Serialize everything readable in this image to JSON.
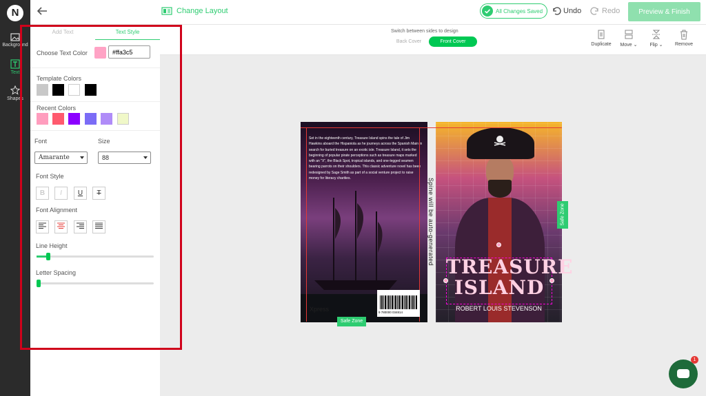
{
  "sidebar": {
    "logo": "N",
    "items": [
      {
        "label": "Background"
      },
      {
        "label": "Text"
      },
      {
        "label": "Shapes"
      }
    ]
  },
  "topbar": {
    "change_layout": "Change Layout",
    "saved": "All Changes Saved",
    "undo": "Undo",
    "redo": "Redo",
    "preview": "Preview & Finish"
  },
  "subbar": {
    "switch_label": "Switch between sides to design",
    "back_cover": "Back Cover",
    "front_cover": "Front Cover",
    "tools": [
      {
        "label": "Duplicate"
      },
      {
        "label": "Move"
      },
      {
        "label": "Flip"
      },
      {
        "label": "Remove"
      }
    ]
  },
  "panel": {
    "tabs": [
      "Add Text",
      "Text Style"
    ],
    "choose_color": "Choose Text Color",
    "color_value": "#ffa3c5",
    "template_colors_label": "Template Colors",
    "template_colors": [
      "#c8c8c8",
      "#000000",
      "#ffffff",
      "#000000"
    ],
    "recent_colors_label": "Recent Colors",
    "recent_colors": [
      "#ff9dbe",
      "#ff5a6e",
      "#8b00ff",
      "#7b6cf6",
      "#b08cf8",
      "#f0f8c8"
    ],
    "font_label": "Font",
    "font_value": "Amarante",
    "size_label": "Size",
    "size_value": "88",
    "font_style_label": "Font Style",
    "style_buttons": [
      "B",
      "I",
      "U",
      "T"
    ],
    "alignment_label": "Font Alignment",
    "line_height_label": "Line Height",
    "line_height_value": 0.1,
    "letter_spacing_label": "Letter Spacing",
    "letter_spacing_value": 0.0
  },
  "book": {
    "blurb": "Set in the eighteenth century, Treasure Island spins the tale of Jim Hawkins aboard the Hispaniola as he journeys across the Spanish Main in search for buried treasure on an exotic isle. Treasure Island, it sets the beginning of popular pirate perceptions such as treasure maps marked with an \"X\", the Black Spot, tropical islands, and one-legged seamen bearing parrots on their shoulders. This classic adventure novel has been redesigned by Sage Smith as part of a social venture project to raise money for literacy charities.",
    "publisher": "Xpress",
    "barcode_number": "9 780000 034814",
    "spine_text": "Spine will be auto-generated",
    "title_line1": "TREASURE",
    "title_line2": "ISLAND",
    "author": "ROBERT LOUIS STEVENSON",
    "safe_zone": "Safe Zone"
  },
  "chat": {
    "badge": "1"
  }
}
